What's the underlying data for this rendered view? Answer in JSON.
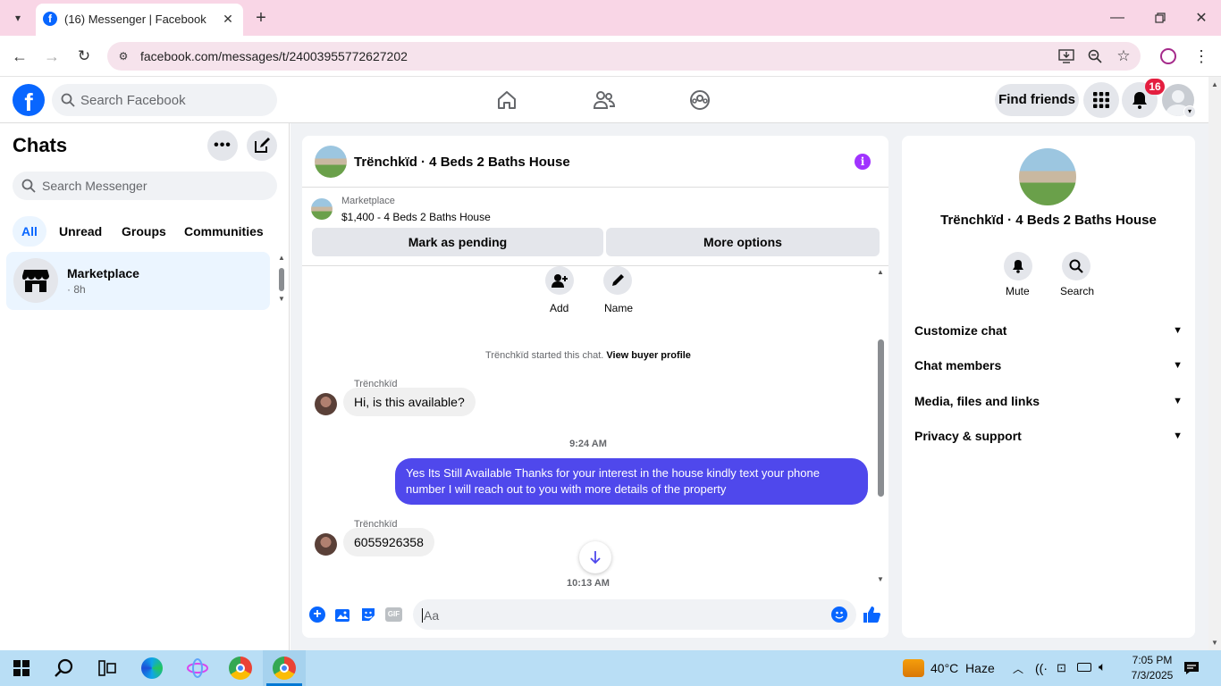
{
  "browser": {
    "tab_title": "(16) Messenger | Facebook",
    "url": "facebook.com/messages/t/24003955772627202"
  },
  "fb_header": {
    "search_placeholder": "Search Facebook",
    "find_friends": "Find friends",
    "notification_count": "16"
  },
  "sidebar": {
    "title": "Chats",
    "search_placeholder": "Search Messenger",
    "filters": [
      "All",
      "Unread",
      "Groups",
      "Communities"
    ],
    "active_filter": "All",
    "chats": [
      {
        "name": "Marketplace",
        "meta": "· 8h"
      }
    ]
  },
  "conversation": {
    "title": "Trënchkïd · 4 Beds 2 Baths House",
    "listing_label": "Marketplace",
    "listing_price": "$1,400 - 4 Beds 2 Baths House",
    "mark_pending": "Mark as pending",
    "more_options": "More options",
    "actions": [
      {
        "icon": "add-person-icon",
        "label": "Add"
      },
      {
        "icon": "pencil-icon",
        "label": "Name"
      }
    ],
    "started_text": "Trënchkïd started this chat.",
    "view_buyer": "View buyer profile",
    "messages": [
      {
        "sender": "Trënchkïd",
        "text": "Hi, is this available?"
      },
      {
        "time": "9:24 AM"
      },
      {
        "text": "Yes Its Still Available Thanks for your interest in the house kindly text your phone number I will reach out to you with more details of the property"
      },
      {
        "sender": "Trënchkïd",
        "text": "6055926358"
      },
      {
        "time": "10:13 AM"
      }
    ],
    "composer_placeholder": "Aa"
  },
  "info_panel": {
    "title": "Trënchkïd · 4 Beds 2 Baths House",
    "actions": [
      "Mute",
      "Search"
    ],
    "sections": [
      "Customize chat",
      "Chat members",
      "Media, files and links",
      "Privacy & support"
    ]
  },
  "taskbar": {
    "weather": "40°C  Haze",
    "time": "7:05 PM",
    "date": "7/3/2025"
  },
  "colors": {
    "fb_blue": "#0866ff",
    "outgoing_bubble": "#4f48ec",
    "accent_purple": "#a033ff",
    "badge_red": "#e41e3f"
  }
}
